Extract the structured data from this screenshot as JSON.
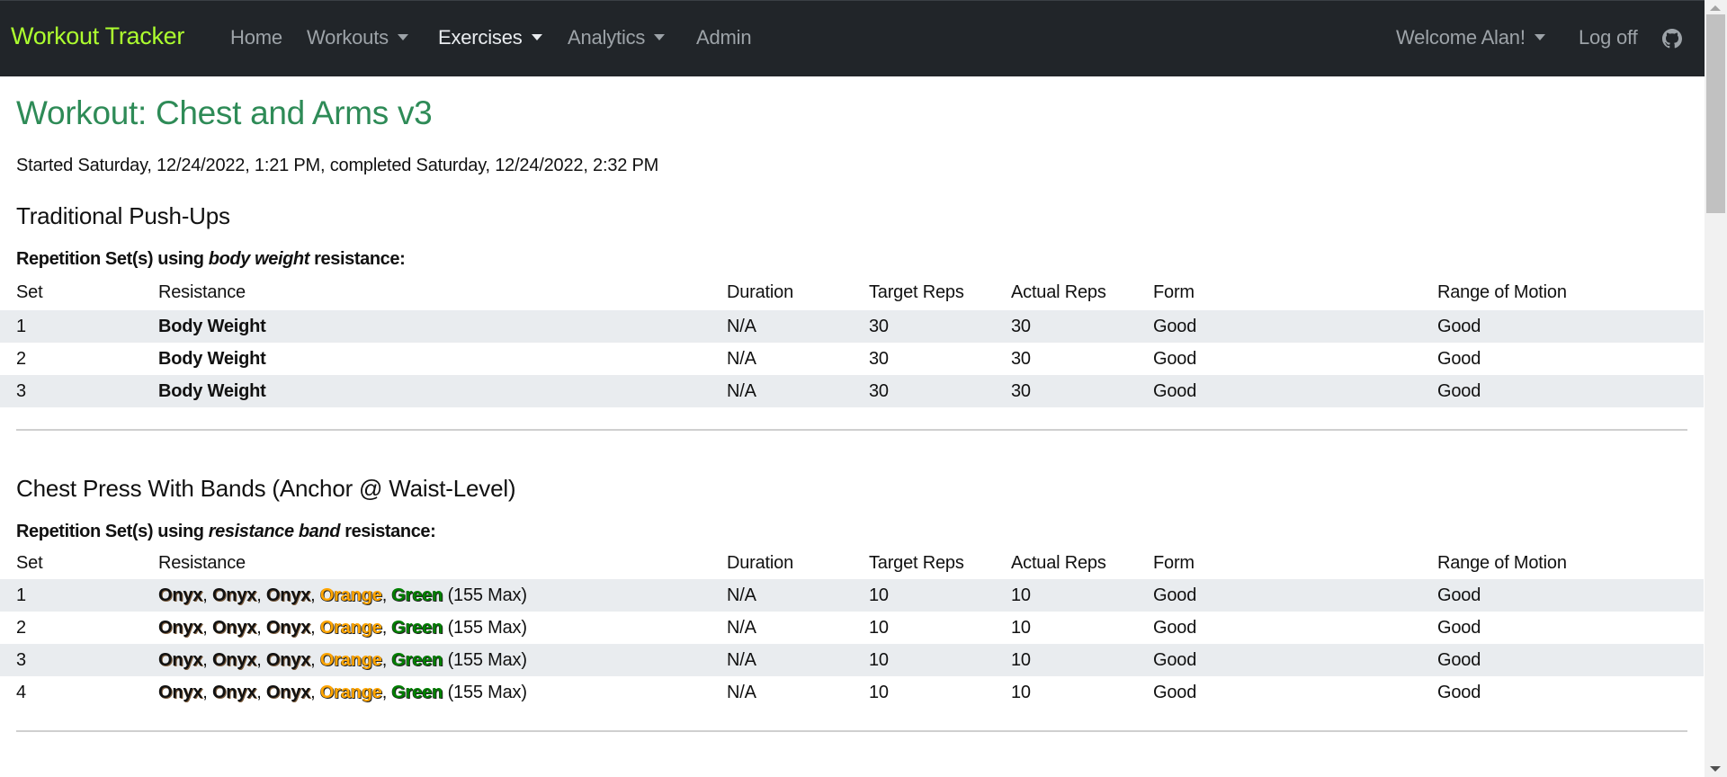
{
  "navbar": {
    "brand": "Workout Tracker",
    "items": [
      {
        "label": "Home",
        "dropdown": false,
        "active": false
      },
      {
        "label": "Workouts",
        "dropdown": true,
        "active": false
      },
      {
        "label": "Exercises",
        "dropdown": true,
        "active": true
      },
      {
        "label": "Analytics",
        "dropdown": true,
        "active": false
      },
      {
        "label": "Admin",
        "dropdown": false,
        "active": false
      }
    ],
    "user_menu": "Welcome Alan!",
    "logoff": "Log off",
    "github_icon": "github-icon"
  },
  "colors": {
    "navbar_bg": "#212529",
    "brand": "#adff2f",
    "title": "#2e8b57",
    "stripe": "#e9ecef",
    "band_onyx": "#111111",
    "band_orange": "#ffa500",
    "band_green": "#008000"
  },
  "page": {
    "title": "Workout: Chest and Arms v3",
    "subtitle": "Started Saturday, 12/24/2022, 1:21 PM, completed Saturday, 12/24/2022, 2:32 PM"
  },
  "table_headers": [
    "Set",
    "Resistance",
    "Duration",
    "Target Reps",
    "Actual Reps",
    "Form",
    "Range of Motion"
  ],
  "exercises": [
    {
      "name": "Traditional Push-Ups",
      "set_label_prefix": "Repetition Set(s) using ",
      "set_label_type": "body weight",
      "set_label_suffix": " resistance:",
      "rows": [
        {
          "set": "1",
          "resistance": "Body Weight",
          "duration": "N/A",
          "target_reps": "30",
          "actual_reps": "30",
          "form": "Good",
          "range_of_motion": "Good"
        },
        {
          "set": "2",
          "resistance": "Body Weight",
          "duration": "N/A",
          "target_reps": "30",
          "actual_reps": "30",
          "form": "Good",
          "range_of_motion": "Good"
        },
        {
          "set": "3",
          "resistance": "Body Weight",
          "duration": "N/A",
          "target_reps": "30",
          "actual_reps": "30",
          "form": "Good",
          "range_of_motion": "Good"
        }
      ]
    },
    {
      "name": "Chest Press With Bands (Anchor @ Waist-Level)",
      "set_label_prefix": "Repetition Set(s) using ",
      "set_label_type": "resistance band",
      "set_label_suffix": " resistance:",
      "rows": [
        {
          "set": "1",
          "bands": [
            "Onyx",
            "Onyx",
            "Onyx",
            "Orange",
            "Green"
          ],
          "max": "(155 Max)",
          "duration": "N/A",
          "target_reps": "10",
          "actual_reps": "10",
          "form": "Good",
          "range_of_motion": "Good"
        },
        {
          "set": "2",
          "bands": [
            "Onyx",
            "Onyx",
            "Onyx",
            "Orange",
            "Green"
          ],
          "max": "(155 Max)",
          "duration": "N/A",
          "target_reps": "10",
          "actual_reps": "10",
          "form": "Good",
          "range_of_motion": "Good"
        },
        {
          "set": "3",
          "bands": [
            "Onyx",
            "Onyx",
            "Onyx",
            "Orange",
            "Green"
          ],
          "max": "(155 Max)",
          "duration": "N/A",
          "target_reps": "10",
          "actual_reps": "10",
          "form": "Good",
          "range_of_motion": "Good"
        },
        {
          "set": "4",
          "bands": [
            "Onyx",
            "Onyx",
            "Onyx",
            "Orange",
            "Green"
          ],
          "max": "(155 Max)",
          "duration": "N/A",
          "target_reps": "10",
          "actual_reps": "10",
          "form": "Good",
          "range_of_motion": "Good"
        }
      ]
    }
  ]
}
